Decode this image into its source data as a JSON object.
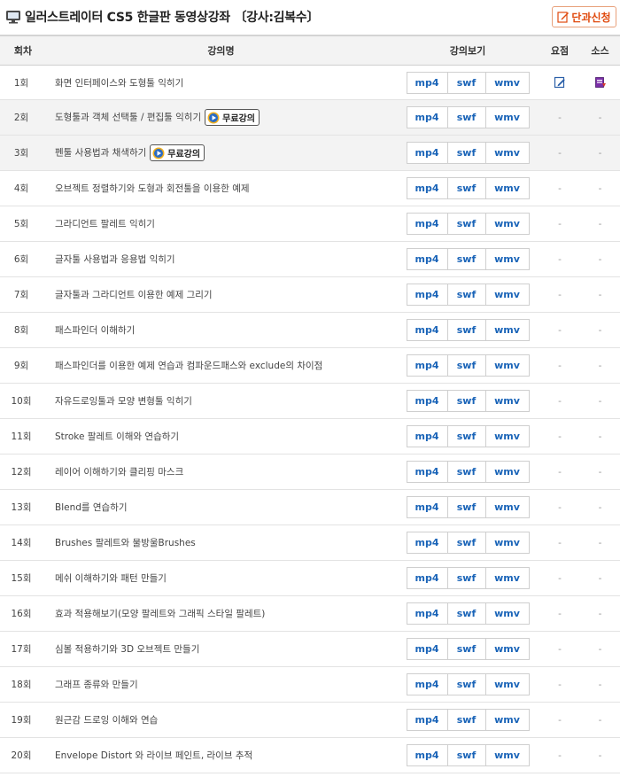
{
  "header": {
    "title": "일러스트레이터 CS5 한글판 동영상강좌 〔강사:김복수〕",
    "apply_label": "단과신청"
  },
  "table": {
    "headers": {
      "no": "회차",
      "name": "강의명",
      "view": "강의보기",
      "summary": "요점",
      "source": "소스"
    },
    "format_labels": {
      "mp4": "mp4",
      "swf": "swf",
      "wmv": "wmv"
    },
    "free_label": "무료강의",
    "dash": "-",
    "rows": [
      {
        "no": "1회",
        "name": "화면 인터페이스와 도형툴 익히기",
        "free": false
      },
      {
        "no": "2회",
        "name": "도형툴과 객체 선택툴 / 편집툴 익히기",
        "free": true
      },
      {
        "no": "3회",
        "name": "펜툴 사용법과 채색하기",
        "free": true
      },
      {
        "no": "4회",
        "name": "오브젝트 정렬하기와 도형과 회전툴을 이용한 예제",
        "free": false
      },
      {
        "no": "5회",
        "name": "그라디언트 팔레트 익히기",
        "free": false
      },
      {
        "no": "6회",
        "name": "글자툴 사용법과 응용법 익히기",
        "free": false
      },
      {
        "no": "7회",
        "name": "글자툴과 그라디언트 이용한 예제 그리기",
        "free": false
      },
      {
        "no": "8회",
        "name": "패스파인더 이해하기",
        "free": false
      },
      {
        "no": "9회",
        "name": "패스파인더를 이용한 예제 연습과 컴파운드패스와 exclude의 차이점",
        "free": false
      },
      {
        "no": "10회",
        "name": "자유드로잉툴과 모양 변형툴 익히기",
        "free": false
      },
      {
        "no": "11회",
        "name": "Stroke 팔레트 이해와 연습하기",
        "free": false
      },
      {
        "no": "12회",
        "name": "레이어 이해하기와 클리핑 마스크",
        "free": false
      },
      {
        "no": "13회",
        "name": "Blend를 연습하기",
        "free": false
      },
      {
        "no": "14회",
        "name": "Brushes 팔레트와 물방울Brushes",
        "free": false
      },
      {
        "no": "15회",
        "name": "메쉬 이해하기와 패턴 만들기",
        "free": false
      },
      {
        "no": "16회",
        "name": "효과 적용해보기(모양 팔레트와 그래픽 스타일 팔레트)",
        "free": false
      },
      {
        "no": "17회",
        "name": "심볼 적용하기와 3D 오브젝트 만들기",
        "free": false
      },
      {
        "no": "18회",
        "name": "그래프 종류와 만들기",
        "free": false
      },
      {
        "no": "19회",
        "name": "원근감 드로잉 이해와 연습",
        "free": false
      },
      {
        "no": "20회",
        "name": "Envelope Distort 와 라이브 페인트, 라이브 추적",
        "free": false
      }
    ]
  }
}
